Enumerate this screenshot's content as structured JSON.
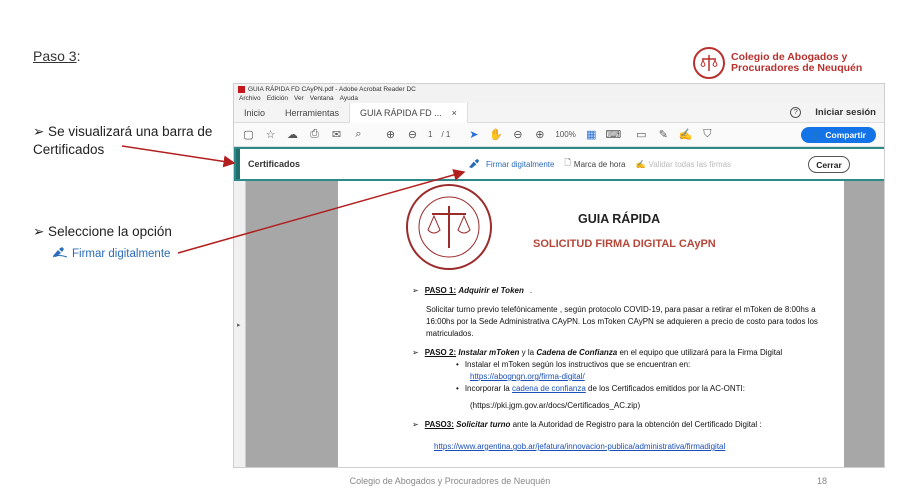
{
  "slide": {
    "title": "Paso 3",
    "title_suffix": ":",
    "logo_line1": "Colegio de Abogados y",
    "logo_line2": "Procuradores de Neuquén",
    "bullet1": "➢ Se visualizará una barra de Certificados",
    "bullet2": "➢ Seleccione la opción",
    "bullet2_option": "Firmar digitalmente",
    "footer": "Colegio de Abogados y Procuradores de Neuquén",
    "page_number": "18",
    "accent_color": "#b8312f"
  },
  "acrobat": {
    "window_title": "GUIA RÁPIDA FD CAyPN.pdf - Adobe Acrobat Reader DC",
    "menu": [
      "Archivo",
      "Edición",
      "Ver",
      "Ventana",
      "Ayuda"
    ],
    "tabs": [
      "Inicio",
      "Herramientas",
      "GUIA RÁPIDA FD ..."
    ],
    "tab_close": "×",
    "help": "?",
    "signin": "Iniciar sesión",
    "page_input": "1",
    "page_total": "/ 1",
    "zoom": "100%",
    "share_label": "Compartir",
    "share_color": "#1473e6",
    "cert_bar": {
      "label": "Certificados",
      "sign": "Firmar digitalmente",
      "timestamp": "Marca de hora",
      "validate": "Validar todas las firmas",
      "close": "Cerrar",
      "border_color": "#2c8a8a"
    }
  },
  "document": {
    "title": "GUIA RÁPIDA",
    "subtitle": "SOLICITUD FIRMA DIGITAL CAyPN",
    "step1_label": "PASO 1:",
    "step1_title": "Adquirir el Token",
    "step1_end": ".",
    "step1_text": "Solicitar turno previo telefónicamente , según protocolo COVID-19, para pasar a retirar el mToken de 8:00hs a 16:00hs por la Sede Administrativa CAyPN. Los mToken CAyPN se adquieren a precio de costo para todos los matriculados.",
    "step2_label": "PASO 2:",
    "step2_title_a": "Instalar mToken",
    "step2_mid": " y la ",
    "step2_title_b": "Cadena de Confianza",
    "step2_rest": " en el equipo que utilizará para la Firma Digital",
    "step2_bullet1": "Instalar el mToken según los instructivos que se encuentran en:",
    "step2_link1": "https://abogngn.org/firma-digital/",
    "step2_bullet2_a": "Incorporar la ",
    "step2_bullet2_link": "cadena de confianza",
    "step2_bullet2_b": " de los Certificados emitidos por la AC-ONTI:",
    "step2_url": "(https://pki.jgm.gov.ar/docs/Certificados_AC.zip)",
    "step3_label": "PASO3:",
    "step3_title": "Solicitar turno",
    "step3_rest": " ante la Autoridad de Registro para la obtención del Certificado Digital :",
    "step3_link": "https://www.argentina.gob.ar/jefatura/innovacion-publica/administrativa/firmadigital"
  }
}
